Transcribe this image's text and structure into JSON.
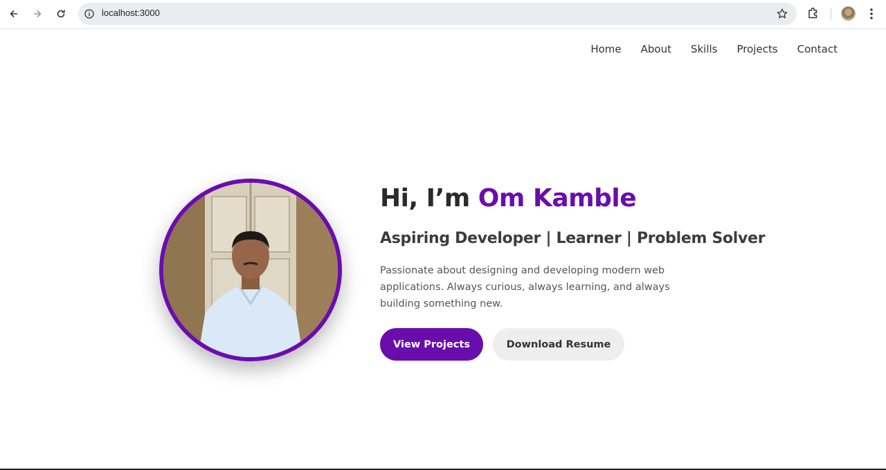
{
  "browser": {
    "url": "localhost:3000",
    "icons": [
      "back-icon",
      "forward-icon",
      "reload-icon",
      "site-info-icon",
      "bookmark-star-icon",
      "extensions-icon",
      "profile-avatar",
      "menu-icon"
    ]
  },
  "nav": {
    "items": [
      {
        "label": "Home"
      },
      {
        "label": "About"
      },
      {
        "label": "Skills"
      },
      {
        "label": "Projects"
      },
      {
        "label": "Contact"
      }
    ]
  },
  "hero": {
    "greeting": "Hi, I’m ",
    "name": "Om Kamble",
    "subtitle": "Aspiring Developer | Learner | Problem Solver",
    "description": "Passionate about designing and developing modern web applications. Always curious, always learning, and always building something new.",
    "primary_button": "View Projects",
    "secondary_button": "Download Resume"
  },
  "colors": {
    "accent": "#6a0dad",
    "text": "#2b2b2b",
    "secondary_button_bg": "#eeeeee"
  }
}
